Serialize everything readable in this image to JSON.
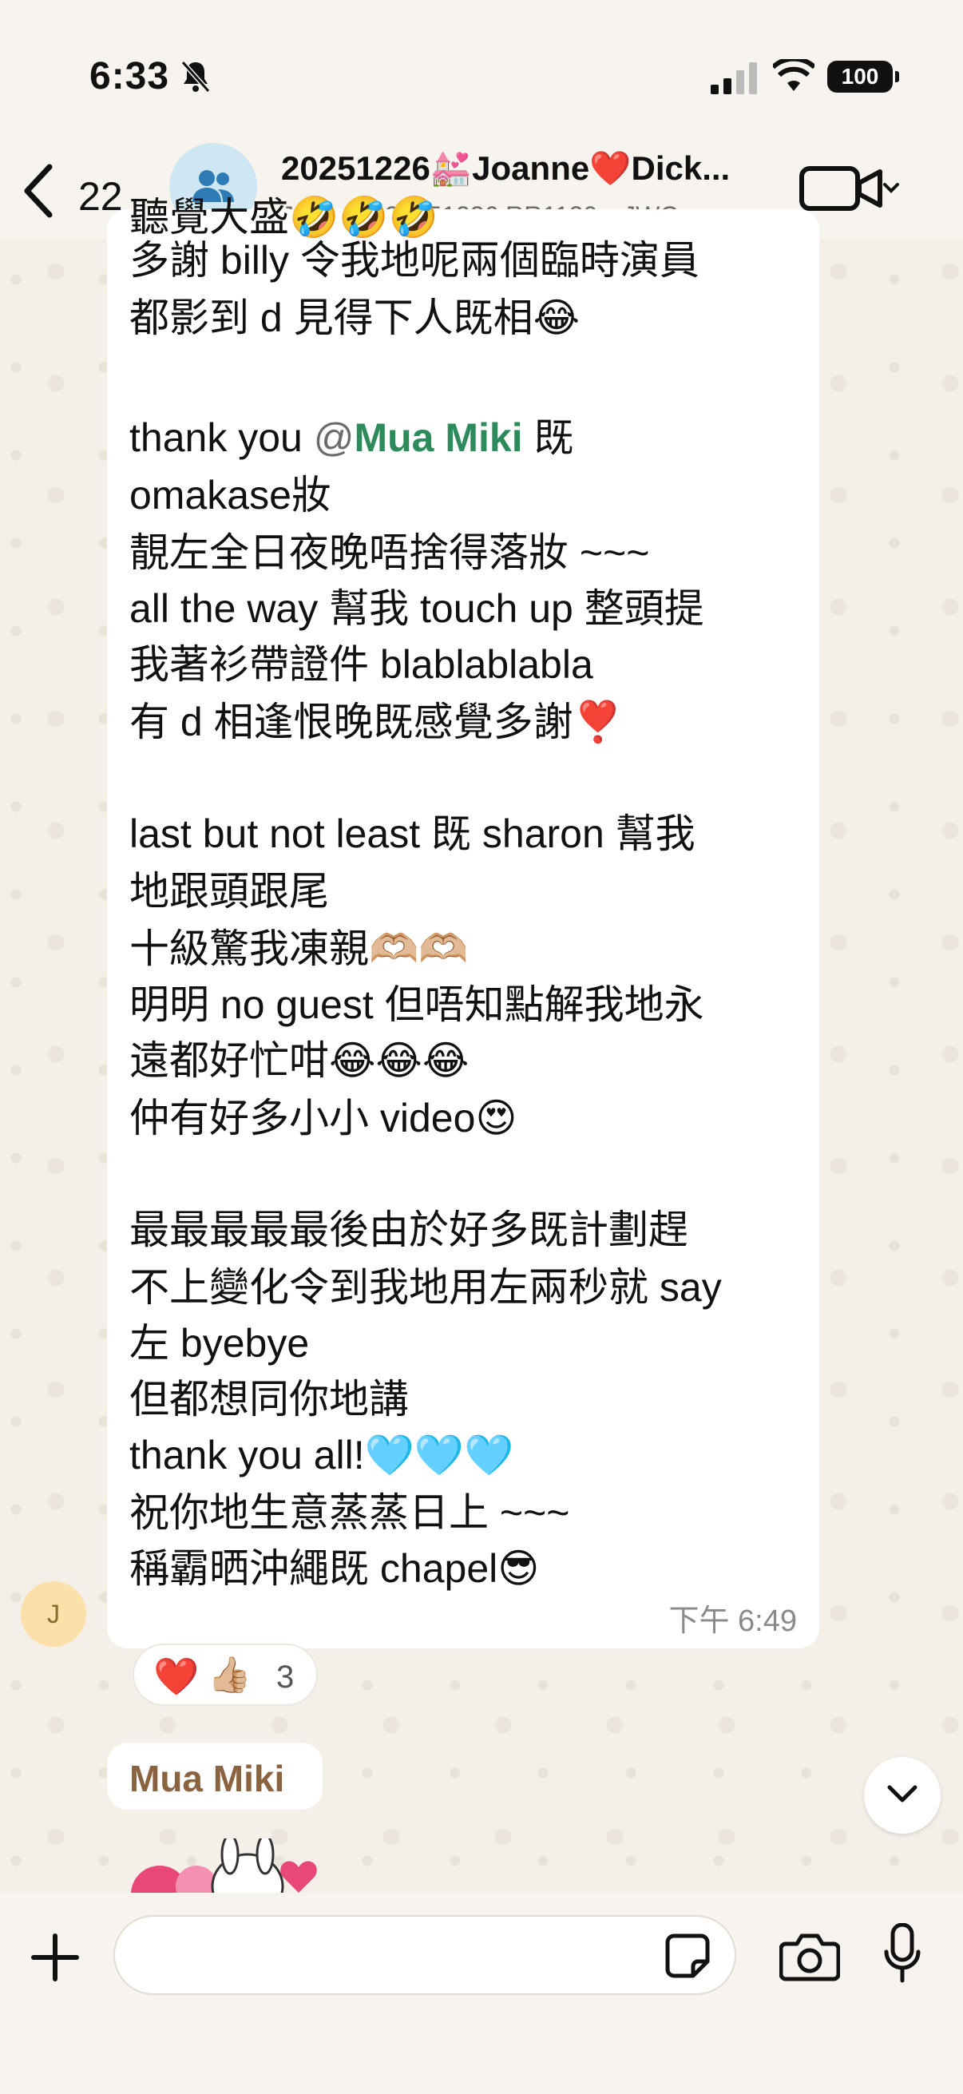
{
  "status_bar": {
    "time": "6:33",
    "battery": "100",
    "icons": [
      "bell-off-icon",
      "signal-icon",
      "wifi-icon",
      "battery-icon"
    ]
  },
  "header": {
    "back_count": "22",
    "title": "20251226💒Joanne❤️Dick...",
    "subtitle": "Joannec 20251226 RR1130、JWC...",
    "icons": [
      "back-chevron-icon",
      "group-icon",
      "video-call-icon",
      "chevron-down-icon"
    ]
  },
  "message": {
    "lines": [
      "聽覺大盛🤣🤣🤣",
      "多謝 billy 令我地呢兩個臨時演員",
      "都影到 d 見得下人既相😂",
      "",
      "thank you ",
      " omakase妝",
      "靚左全日夜晚唔捨得落妝 ~~~",
      "all the way 幫我 touch up 整頭提",
      "我著衫帶證件 blablablabla",
      "有 d 相逢恨晚既感覺多謝❣️",
      "",
      "last but not least 既 sharon 幫我",
      "地跟頭跟尾",
      "十級驚我凍親🫶🏼🫶🏼",
      "明明 no guest 但唔知點解我地永",
      "遠都好忙咁😂😂😂",
      "仲有好多小小 video😍",
      "",
      "最最最最最後由於好多既計劃趕",
      "不上變化令到我地用左兩秒就 say",
      "左 byebye",
      "但都想同你地講",
      "thank you all!🩵🩵🩵",
      "祝你地生意蒸蒸日上 ~~~",
      "稱霸晒沖繩既 chapel😎"
    ],
    "mention_at": "@",
    "mention_name": "Mua Miki",
    "mention_suffix": " 既",
    "time": "下午 6:49",
    "sender_initial": "J"
  },
  "reactions": {
    "heart": "❤️",
    "thumb": "👍🏼",
    "count": "3"
  },
  "next_message": {
    "sender_name": "Mua Miki"
  },
  "composer": {
    "placeholder": "",
    "icons": [
      "plus-icon",
      "sticker-icon",
      "camera-icon",
      "mic-icon"
    ]
  }
}
